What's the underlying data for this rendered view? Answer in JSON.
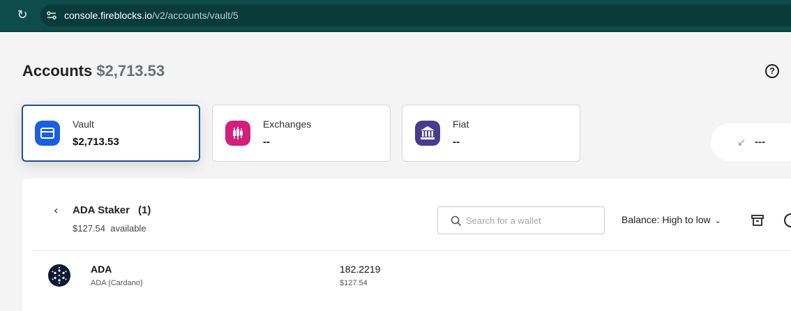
{
  "browser": {
    "reload_icon": "reload-icon",
    "site_info_icon": "site-settings-icon",
    "url_host": "console.fireblocks.io",
    "url_path": "/v2/accounts/vault/5"
  },
  "header": {
    "title": "Accounts",
    "total": "$2,713.53",
    "help_icon": "help-icon",
    "help_glyph": "?"
  },
  "cards": [
    {
      "label": "Vault",
      "value": "$2,713.53",
      "icon": "vault-icon",
      "color": "#1a5fe0"
    },
    {
      "label": "Exchanges",
      "value": "--",
      "icon": "exchange-candles-icon",
      "color": "#d21f7c"
    },
    {
      "label": "Fiat",
      "value": "--",
      "icon": "bank-icon",
      "color": "#463d8f"
    }
  ],
  "side_card": {
    "arrow": "↙",
    "value": "---"
  },
  "wallet": {
    "back_glyph": "‹",
    "name": "ADA Staker",
    "count": "(1)",
    "available_amount": "$127.54",
    "available_label": "available"
  },
  "search": {
    "placeholder": "Search for a wallet",
    "value": ""
  },
  "sort": {
    "label": "Balance: High to low",
    "chevron": "⌄"
  },
  "assets": [
    {
      "symbol": "ADA",
      "name": "ADA (Cardano)",
      "amount": "182.2219",
      "usd": "$127.54",
      "icon": "cardano-icon"
    }
  ],
  "colors": {
    "browser_bar": "#0e4b4b",
    "active_border": "#1d4f91"
  }
}
